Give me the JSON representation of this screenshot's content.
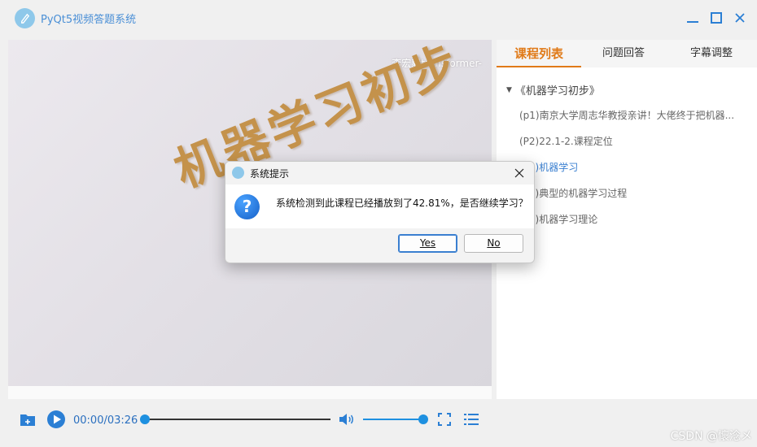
{
  "window": {
    "title": "PyQt5视频答题系统",
    "icon": "app-logo-icon"
  },
  "video": {
    "watermark": "李宏毅transformer-",
    "overlay_title": "机器学习初步"
  },
  "panel": {
    "tabs": [
      {
        "label": "课程列表",
        "active": true
      },
      {
        "label": "问题回答",
        "active": false
      },
      {
        "label": "字幕调整",
        "active": false
      }
    ],
    "tree": {
      "root": "《机器学习初步》",
      "items": [
        {
          "label": "(p1)南京大学周志华教授亲讲！大佬终于把机器...",
          "selected": false
        },
        {
          "label": "(P2)22.1-2.课程定位",
          "selected": false
        },
        {
          "label": "(P3)机器学习",
          "selected": true
        },
        {
          "label": "(P4)典型的机器学习过程",
          "selected": false
        },
        {
          "label": "(P5)机器学习理论",
          "selected": false
        }
      ]
    }
  },
  "controls": {
    "time": "00:00/03:26",
    "progress": 0.0,
    "volume": 1.0
  },
  "dialog": {
    "title": "系统提示",
    "message": "系统检测到此课程已经播放到了42.81%，是否继续学习？",
    "yes_label": "Yes",
    "no_label": "No",
    "question_glyph": "?"
  },
  "watermark_corner": "CSDN @懷淰メ",
  "colors": {
    "accent_orange": "#e07a18",
    "accent_blue": "#1e90e0",
    "link_blue": "#3a7fd0"
  }
}
